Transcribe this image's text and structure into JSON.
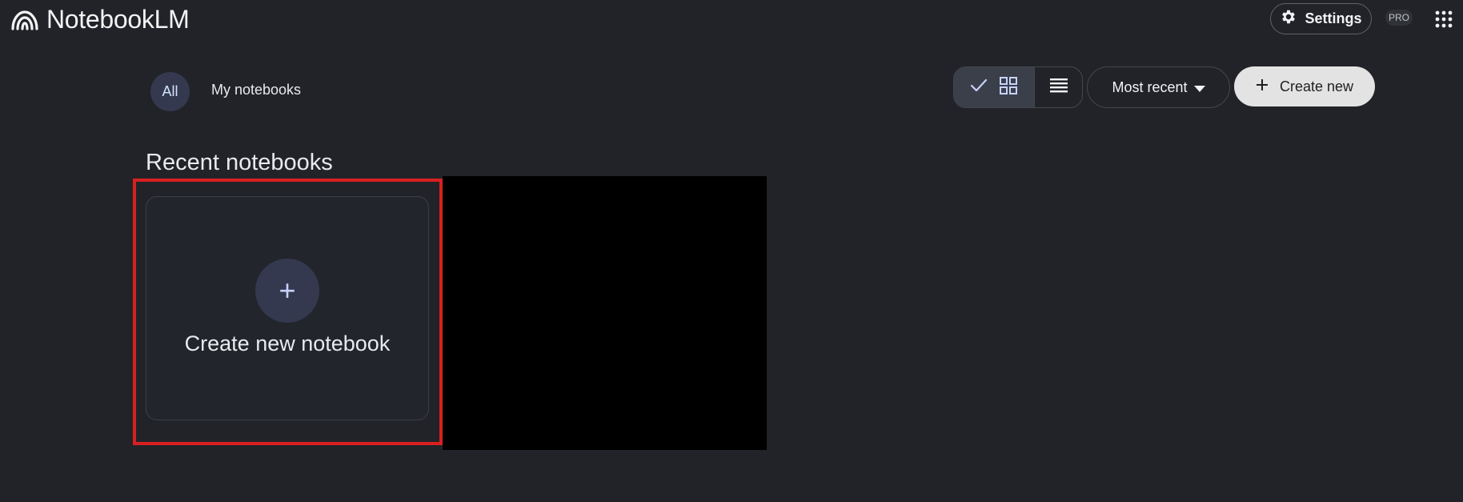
{
  "app": {
    "title": "NotebookLM"
  },
  "header": {
    "settings_label": "Settings",
    "pro_badge": "PRO"
  },
  "filters": {
    "all_label": "All",
    "mine_label": "My notebooks"
  },
  "toolbar": {
    "sort_label": "Most recent",
    "create_label": "Create new"
  },
  "main": {
    "section_title": "Recent notebooks",
    "create_card": {
      "plus_symbol": "+",
      "label": "Create new notebook"
    }
  },
  "colors": {
    "background": "#212328",
    "accent_chip": "#34394f",
    "highlight": "#d92020",
    "create_button": "#e3e3e3"
  },
  "icons": [
    "notebooklm-logo-icon",
    "gear-icon",
    "apps-grid-icon",
    "check-icon",
    "grid-view-icon",
    "list-view-icon",
    "dropdown-arrow-icon",
    "plus-icon"
  ]
}
